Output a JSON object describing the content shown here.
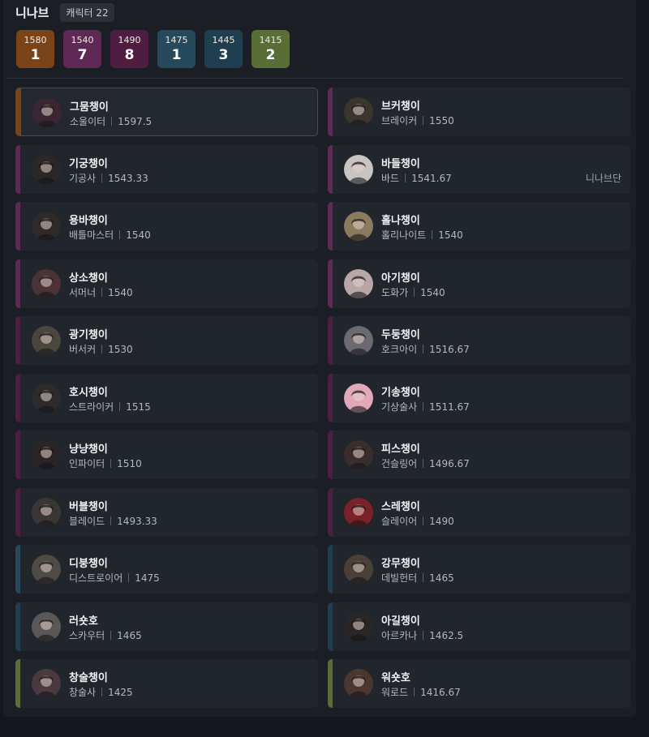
{
  "header": {
    "server": "니나브",
    "character_count": "캐릭터 22"
  },
  "tiers": [
    {
      "level": "1580",
      "count": "1",
      "color": "#7a4418"
    },
    {
      "level": "1540",
      "count": "7",
      "color": "#5e2a55"
    },
    {
      "level": "1490",
      "count": "8",
      "color": "#4f1d42"
    },
    {
      "level": "1475",
      "count": "1",
      "color": "#26495b"
    },
    {
      "level": "1445",
      "count": "3",
      "color": "#1f3e50"
    },
    {
      "level": "1415",
      "count": "2",
      "color": "#596e36"
    }
  ],
  "characters": [
    {
      "name": "그뭄챙이",
      "class": "소울이터",
      "level": "1597.5",
      "guild": "",
      "bar_color": "#7a4418",
      "avatar_color": "#3a2630",
      "selected": true
    },
    {
      "name": "브커챙이",
      "class": "브레이커",
      "level": "1550",
      "guild": "",
      "bar_color": "#5e2a55",
      "avatar_color": "#3b352f"
    },
    {
      "name": "기궁챙이",
      "class": "기공사",
      "level": "1543.33",
      "guild": "",
      "bar_color": "#5e2a55",
      "avatar_color": "#2b2726"
    },
    {
      "name": "바들챙이",
      "class": "바드",
      "level": "1541.67",
      "guild": "니나브단",
      "bar_color": "#5e2a55",
      "avatar_color": "#c8c4c0"
    },
    {
      "name": "용바챙이",
      "class": "배틀마스터",
      "level": "1540",
      "guild": "",
      "bar_color": "#5e2a55",
      "avatar_color": "#2e2a28"
    },
    {
      "name": "홀나챙이",
      "class": "홀리나이트",
      "level": "1540",
      "guild": "",
      "bar_color": "#5e2a55",
      "avatar_color": "#8a7a5e"
    },
    {
      "name": "상소챙이",
      "class": "서머너",
      "level": "1540",
      "guild": "",
      "bar_color": "#5e2a55",
      "avatar_color": "#4a3236"
    },
    {
      "name": "아기챙이",
      "class": "도화가",
      "level": "1540",
      "guild": "",
      "bar_color": "#5e2a55",
      "avatar_color": "#b8a6a8"
    },
    {
      "name": "광기챙이",
      "class": "버서커",
      "level": "1530",
      "guild": "",
      "bar_color": "#4f1d42",
      "avatar_color": "#4a463e"
    },
    {
      "name": "두둥챙이",
      "class": "호크아이",
      "level": "1516.67",
      "guild": "",
      "bar_color": "#4f1d42",
      "avatar_color": "#6a6a70"
    },
    {
      "name": "호시챙이",
      "class": "스트라이커",
      "level": "1515",
      "guild": "",
      "bar_color": "#4f1d42",
      "avatar_color": "#2c2a2a"
    },
    {
      "name": "기송챙이",
      "class": "기상술사",
      "level": "1511.67",
      "guild": "",
      "bar_color": "#4f1d42",
      "avatar_color": "#e0a8b8"
    },
    {
      "name": "냥냥챙이",
      "class": "인파이터",
      "level": "1510",
      "guild": "",
      "bar_color": "#4f1d42",
      "avatar_color": "#2a2426"
    },
    {
      "name": "피스챙이",
      "class": "건슬링어",
      "level": "1496.67",
      "guild": "",
      "bar_color": "#4f1d42",
      "avatar_color": "#3a2e2c"
    },
    {
      "name": "버블챙이",
      "class": "블레이드",
      "level": "1493.33",
      "guild": "",
      "bar_color": "#4f1d42",
      "avatar_color": "#3a3634"
    },
    {
      "name": "스레챙이",
      "class": "슬레이어",
      "level": "1490",
      "guild": "",
      "bar_color": "#4f1d42",
      "avatar_color": "#7a2228"
    },
    {
      "name": "디붕챙이",
      "class": "디스트로이어",
      "level": "1475",
      "guild": "",
      "bar_color": "#26495b",
      "avatar_color": "#4e4a44"
    },
    {
      "name": "강무챙이",
      "class": "데빌헌터",
      "level": "1465",
      "guild": "",
      "bar_color": "#1f3e50",
      "avatar_color": "#4a4038"
    },
    {
      "name": "러숏호",
      "class": "스카우터",
      "level": "1465",
      "guild": "",
      "bar_color": "#1f3e50",
      "avatar_color": "#5a5856"
    },
    {
      "name": "아길챙이",
      "class": "아르카나",
      "level": "1462.5",
      "guild": "",
      "bar_color": "#1f3e50",
      "avatar_color": "#2a2628"
    },
    {
      "name": "창술챙이",
      "class": "창술사",
      "level": "1425",
      "guild": "",
      "bar_color": "#596e36",
      "avatar_color": "#4a3a40"
    },
    {
      "name": "워숏호",
      "class": "워로드",
      "level": "1416.67",
      "guild": "",
      "bar_color": "#596e36",
      "avatar_color": "#4a3830"
    }
  ]
}
